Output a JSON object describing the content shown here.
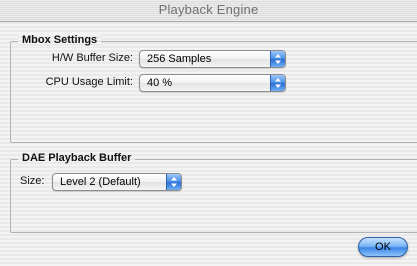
{
  "window": {
    "title": "Playback Engine"
  },
  "mbox_settings": {
    "title": "Mbox Settings",
    "hw_buffer_size": {
      "label": "H/W Buffer Size:",
      "value": "256 Samples"
    },
    "cpu_usage_limit": {
      "label": "CPU Usage Limit:",
      "value": "40 %"
    }
  },
  "dae_playback_buffer": {
    "title": "DAE Playback Buffer",
    "size": {
      "label": "Size:",
      "value": "Level 2 (Default)"
    }
  },
  "footer": {
    "ok_label": "OK"
  },
  "colors": {
    "aqua_blue": "#3d86e6",
    "groupbox_border": "#b2b2b2"
  },
  "icons": {
    "popup_arrows": "up-down-arrows-icon"
  }
}
